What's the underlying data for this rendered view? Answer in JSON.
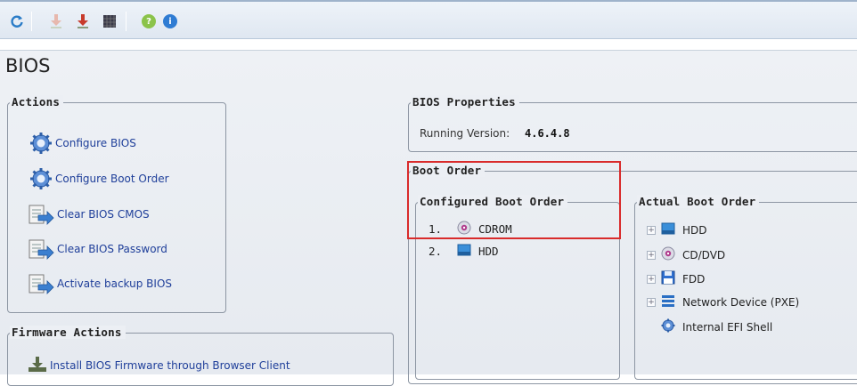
{
  "toolbar": {
    "icons": [
      "refresh-icon",
      "download-disabled-icon",
      "download-icon",
      "grid-icon",
      "help-icon",
      "info-icon"
    ],
    "colors": {
      "refresh": "#2a7cc7",
      "download": "#c83b2c",
      "help": "#8bc34a",
      "info": "#2f7cd3"
    }
  },
  "page": {
    "title": "BIOS"
  },
  "actions": {
    "legend": "Actions",
    "items": [
      {
        "label": "Configure BIOS",
        "icon": "gear-icon"
      },
      {
        "label": "Configure Boot Order",
        "icon": "gear-icon"
      },
      {
        "label": "Clear BIOS CMOS",
        "icon": "document-arrow-icon"
      },
      {
        "label": "Clear BIOS Password",
        "icon": "document-arrow-icon"
      },
      {
        "label": "Activate backup BIOS",
        "icon": "document-arrow-icon"
      }
    ]
  },
  "firmware_actions": {
    "legend": "Firmware Actions",
    "items": [
      {
        "label": "Install BIOS Firmware through Browser Client",
        "icon": "install-icon"
      }
    ]
  },
  "bios_properties": {
    "legend": "BIOS Properties",
    "running_version_label": "Running Version:",
    "running_version_value": "4.6.4.8"
  },
  "boot_order": {
    "legend": "Boot Order",
    "configured": {
      "legend": "Configured Boot Order",
      "items": [
        {
          "index": "1.",
          "label": "CDROM",
          "icon": "cdrom-icon"
        },
        {
          "index": "2.",
          "label": "HDD",
          "icon": "hdd-icon"
        }
      ]
    },
    "actual": {
      "legend": "Actual Boot Order",
      "items": [
        {
          "label": "HDD",
          "icon": "hdd-icon",
          "expandable": true
        },
        {
          "label": "CD/DVD",
          "icon": "cdrom-icon",
          "expandable": true
        },
        {
          "label": "FDD",
          "icon": "floppy-icon",
          "expandable": true
        },
        {
          "label": "Network Device (PXE)",
          "icon": "network-icon",
          "expandable": true
        },
        {
          "label": "Internal EFI Shell",
          "icon": "efi-gear-icon",
          "expandable": false
        }
      ]
    }
  },
  "highlight_color": "#d92b2b"
}
